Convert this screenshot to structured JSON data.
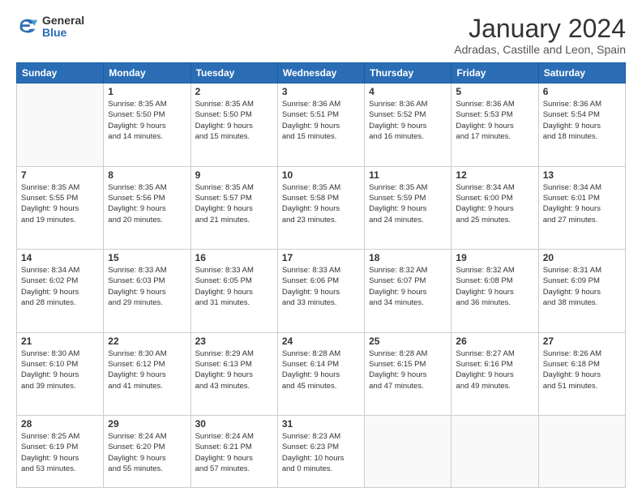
{
  "logo": {
    "general": "General",
    "blue": "Blue"
  },
  "header": {
    "month": "January 2024",
    "location": "Adradas, Castille and Leon, Spain"
  },
  "weekdays": [
    "Sunday",
    "Monday",
    "Tuesday",
    "Wednesday",
    "Thursday",
    "Friday",
    "Saturday"
  ],
  "weeks": [
    [
      {
        "day": "",
        "info": ""
      },
      {
        "day": "1",
        "info": "Sunrise: 8:35 AM\nSunset: 5:50 PM\nDaylight: 9 hours\nand 14 minutes."
      },
      {
        "day": "2",
        "info": "Sunrise: 8:35 AM\nSunset: 5:50 PM\nDaylight: 9 hours\nand 15 minutes."
      },
      {
        "day": "3",
        "info": "Sunrise: 8:36 AM\nSunset: 5:51 PM\nDaylight: 9 hours\nand 15 minutes."
      },
      {
        "day": "4",
        "info": "Sunrise: 8:36 AM\nSunset: 5:52 PM\nDaylight: 9 hours\nand 16 minutes."
      },
      {
        "day": "5",
        "info": "Sunrise: 8:36 AM\nSunset: 5:53 PM\nDaylight: 9 hours\nand 17 minutes."
      },
      {
        "day": "6",
        "info": "Sunrise: 8:36 AM\nSunset: 5:54 PM\nDaylight: 9 hours\nand 18 minutes."
      }
    ],
    [
      {
        "day": "7",
        "info": "Sunrise: 8:35 AM\nSunset: 5:55 PM\nDaylight: 9 hours\nand 19 minutes."
      },
      {
        "day": "8",
        "info": "Sunrise: 8:35 AM\nSunset: 5:56 PM\nDaylight: 9 hours\nand 20 minutes."
      },
      {
        "day": "9",
        "info": "Sunrise: 8:35 AM\nSunset: 5:57 PM\nDaylight: 9 hours\nand 21 minutes."
      },
      {
        "day": "10",
        "info": "Sunrise: 8:35 AM\nSunset: 5:58 PM\nDaylight: 9 hours\nand 23 minutes."
      },
      {
        "day": "11",
        "info": "Sunrise: 8:35 AM\nSunset: 5:59 PM\nDaylight: 9 hours\nand 24 minutes."
      },
      {
        "day": "12",
        "info": "Sunrise: 8:34 AM\nSunset: 6:00 PM\nDaylight: 9 hours\nand 25 minutes."
      },
      {
        "day": "13",
        "info": "Sunrise: 8:34 AM\nSunset: 6:01 PM\nDaylight: 9 hours\nand 27 minutes."
      }
    ],
    [
      {
        "day": "14",
        "info": "Sunrise: 8:34 AM\nSunset: 6:02 PM\nDaylight: 9 hours\nand 28 minutes."
      },
      {
        "day": "15",
        "info": "Sunrise: 8:33 AM\nSunset: 6:03 PM\nDaylight: 9 hours\nand 29 minutes."
      },
      {
        "day": "16",
        "info": "Sunrise: 8:33 AM\nSunset: 6:05 PM\nDaylight: 9 hours\nand 31 minutes."
      },
      {
        "day": "17",
        "info": "Sunrise: 8:33 AM\nSunset: 6:06 PM\nDaylight: 9 hours\nand 33 minutes."
      },
      {
        "day": "18",
        "info": "Sunrise: 8:32 AM\nSunset: 6:07 PM\nDaylight: 9 hours\nand 34 minutes."
      },
      {
        "day": "19",
        "info": "Sunrise: 8:32 AM\nSunset: 6:08 PM\nDaylight: 9 hours\nand 36 minutes."
      },
      {
        "day": "20",
        "info": "Sunrise: 8:31 AM\nSunset: 6:09 PM\nDaylight: 9 hours\nand 38 minutes."
      }
    ],
    [
      {
        "day": "21",
        "info": "Sunrise: 8:30 AM\nSunset: 6:10 PM\nDaylight: 9 hours\nand 39 minutes."
      },
      {
        "day": "22",
        "info": "Sunrise: 8:30 AM\nSunset: 6:12 PM\nDaylight: 9 hours\nand 41 minutes."
      },
      {
        "day": "23",
        "info": "Sunrise: 8:29 AM\nSunset: 6:13 PM\nDaylight: 9 hours\nand 43 minutes."
      },
      {
        "day": "24",
        "info": "Sunrise: 8:28 AM\nSunset: 6:14 PM\nDaylight: 9 hours\nand 45 minutes."
      },
      {
        "day": "25",
        "info": "Sunrise: 8:28 AM\nSunset: 6:15 PM\nDaylight: 9 hours\nand 47 minutes."
      },
      {
        "day": "26",
        "info": "Sunrise: 8:27 AM\nSunset: 6:16 PM\nDaylight: 9 hours\nand 49 minutes."
      },
      {
        "day": "27",
        "info": "Sunrise: 8:26 AM\nSunset: 6:18 PM\nDaylight: 9 hours\nand 51 minutes."
      }
    ],
    [
      {
        "day": "28",
        "info": "Sunrise: 8:25 AM\nSunset: 6:19 PM\nDaylight: 9 hours\nand 53 minutes."
      },
      {
        "day": "29",
        "info": "Sunrise: 8:24 AM\nSunset: 6:20 PM\nDaylight: 9 hours\nand 55 minutes."
      },
      {
        "day": "30",
        "info": "Sunrise: 8:24 AM\nSunset: 6:21 PM\nDaylight: 9 hours\nand 57 minutes."
      },
      {
        "day": "31",
        "info": "Sunrise: 8:23 AM\nSunset: 6:23 PM\nDaylight: 10 hours\nand 0 minutes."
      },
      {
        "day": "",
        "info": ""
      },
      {
        "day": "",
        "info": ""
      },
      {
        "day": "",
        "info": ""
      }
    ]
  ]
}
